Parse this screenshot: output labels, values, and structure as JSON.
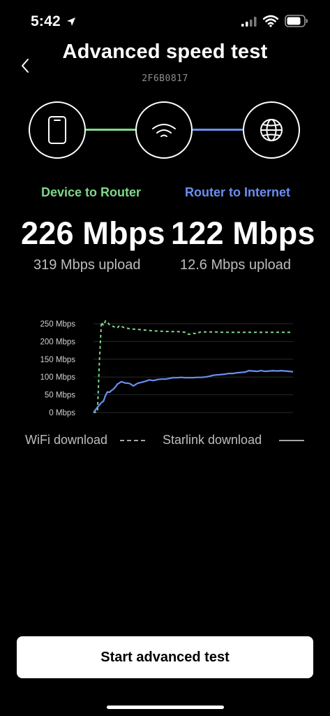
{
  "status_bar": {
    "time": "5:42",
    "icons": [
      "location-arrow-icon",
      "cellular-signal-icon",
      "wifi-icon",
      "battery-icon"
    ]
  },
  "header": {
    "title": "Advanced speed test",
    "device_id": "2F6B0817",
    "back_icon": "chevron-left-icon"
  },
  "diagram": {
    "nodes": [
      "phone-icon",
      "wifi-router-icon",
      "globe-icon"
    ],
    "colors": {
      "device_to_router": "#7ed98a",
      "router_to_internet": "#6b8ff0"
    }
  },
  "stats": {
    "device_to_router": {
      "label": "Device to Router",
      "download": "226 Mbps",
      "upload": "319 Mbps upload"
    },
    "router_to_internet": {
      "label": "Router to Internet",
      "download": "122 Mbps",
      "upload": "12.6 Mbps upload"
    }
  },
  "chart_data": {
    "type": "line",
    "y_tick_labels": [
      "250 Mbps",
      "200 Mbps",
      "150 Mbps",
      "100 Mbps",
      "50 Mbps",
      "0 Mbps"
    ],
    "ylim": [
      0,
      250
    ],
    "grid": true,
    "legend_position": "bottom",
    "series": [
      {
        "name": "WiFi download",
        "style": "dashed",
        "color": "#7ed98a",
        "points": [
          [
            0,
            0
          ],
          [
            2,
            2
          ],
          [
            3,
            150
          ],
          [
            4,
            255
          ],
          [
            5,
            245
          ],
          [
            6,
            258
          ],
          [
            7,
            255
          ],
          [
            8,
            247
          ],
          [
            10,
            242
          ],
          [
            12,
            238
          ],
          [
            13,
            245
          ],
          [
            15,
            240
          ],
          [
            18,
            236
          ],
          [
            22,
            234
          ],
          [
            26,
            232
          ],
          [
            30,
            230
          ],
          [
            34,
            229
          ],
          [
            38,
            228
          ],
          [
            42,
            228
          ],
          [
            46,
            226
          ],
          [
            47,
            222
          ],
          [
            48,
            220
          ],
          [
            50,
            223
          ],
          [
            52,
            222
          ],
          [
            53,
            226
          ],
          [
            56,
            227
          ],
          [
            60,
            227
          ],
          [
            65,
            226
          ],
          [
            70,
            226
          ],
          [
            75,
            226
          ],
          [
            80,
            226
          ],
          [
            85,
            226
          ],
          [
            90,
            226
          ],
          [
            95,
            226
          ],
          [
            100,
            226
          ]
        ]
      },
      {
        "name": "Starlink download",
        "style": "solid",
        "color": "#6b8ff0",
        "points": [
          [
            0,
            0
          ],
          [
            2,
            15
          ],
          [
            4,
            28
          ],
          [
            5,
            32
          ],
          [
            6,
            48
          ],
          [
            7,
            58
          ],
          [
            8,
            57
          ],
          [
            9,
            62
          ],
          [
            10,
            66
          ],
          [
            11,
            72
          ],
          [
            12,
            80
          ],
          [
            14,
            87
          ],
          [
            16,
            83
          ],
          [
            18,
            82
          ],
          [
            20,
            75
          ],
          [
            22,
            82
          ],
          [
            24,
            85
          ],
          [
            26,
            88
          ],
          [
            28,
            92
          ],
          [
            30,
            90
          ],
          [
            32,
            93
          ],
          [
            34,
            94
          ],
          [
            36,
            94
          ],
          [
            38,
            96
          ],
          [
            40,
            98
          ],
          [
            42,
            98
          ],
          [
            44,
            99
          ],
          [
            46,
            98
          ],
          [
            48,
            98
          ],
          [
            50,
            98
          ],
          [
            52,
            99
          ],
          [
            54,
            99
          ],
          [
            56,
            100
          ],
          [
            58,
            102
          ],
          [
            60,
            105
          ],
          [
            62,
            106
          ],
          [
            64,
            107
          ],
          [
            66,
            108
          ],
          [
            68,
            110
          ],
          [
            70,
            110
          ],
          [
            72,
            112
          ],
          [
            74,
            113
          ],
          [
            76,
            114
          ],
          [
            78,
            118
          ],
          [
            80,
            117
          ],
          [
            82,
            116
          ],
          [
            84,
            118
          ],
          [
            86,
            116
          ],
          [
            88,
            117
          ],
          [
            90,
            118
          ],
          [
            92,
            117
          ],
          [
            94,
            118
          ],
          [
            96,
            117
          ],
          [
            98,
            116
          ],
          [
            100,
            115
          ]
        ]
      }
    ]
  },
  "legend": {
    "wifi": "WiFi download",
    "starlink": "Starlink download"
  },
  "actions": {
    "start_label": "Start advanced test"
  }
}
